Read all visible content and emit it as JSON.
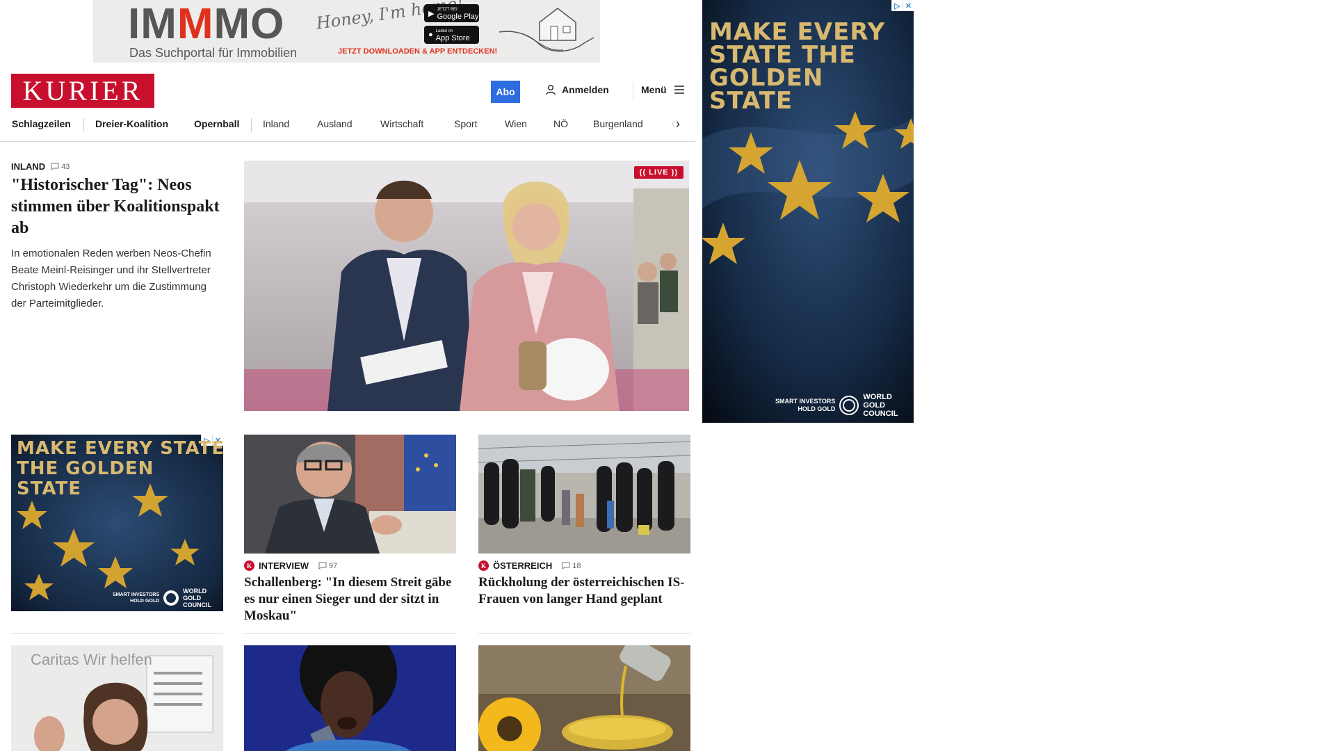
{
  "top_ad": {
    "logo_part1": "IM",
    "logo_part2": "M",
    "logo_part3": "MO",
    "tagline": "Das Suchportal für Immobilien",
    "script": "Honey, I'm home!",
    "google_play": "Google Play",
    "google_play_small": "JETZT BEI",
    "app_store": "App Store",
    "app_store_small": "Laden im",
    "cta": "JETZT DOWNLOADEN & APP ENTDECKEN!"
  },
  "header": {
    "logo": "KURIER",
    "abo": "Abo",
    "login": "Anmelden",
    "menu": "Menü"
  },
  "nav": {
    "items": [
      "Schlagzeilen",
      "Dreier-Koalition",
      "Opernball",
      "Inland",
      "Ausland",
      "Wirtschaft",
      "Sport",
      "Wien",
      "NÖ",
      "Burgenland",
      "Ö"
    ]
  },
  "lead": {
    "kicker": "INLAND",
    "comments": "43",
    "title": "\"Historischer Tag\": Neos stimmen über Koalitionspakt ab",
    "teaser": "In emotionalen Reden werben Neos-Chefin Beate Meinl-Reisinger und ihr Stellvertreter Christoph Wiederkehr um die Zustimmung der Parteimitglieder.",
    "live": "(( LIVE ))"
  },
  "side_ad": {
    "headline": "MAKE EVERY STATE THE GOLDEN STATE",
    "smart": "SMART INVESTORS",
    "hold": "HOLD GOLD",
    "wgc1": "WORLD",
    "wgc2": "GOLD",
    "wgc3": "COUNCIL"
  },
  "small_ad": {
    "headline": "MAKE EVERY STATE THE GOLDEN STATE"
  },
  "cards": [
    {
      "kicker": "INTERVIEW",
      "comments": "97",
      "title": "Schallenberg: \"In diesem Streit gäbe es nur einen Sieger und der sitzt in Moskau\""
    },
    {
      "kicker": "ÖSTERREICH",
      "comments": "18",
      "title": "Rückholung der österreichischen IS-Frauen von langer Hand geplant"
    }
  ],
  "row3_images": [
    "Caritas Wir helfen"
  ],
  "adchoice": {
    "info": "▷",
    "close": "✕"
  }
}
